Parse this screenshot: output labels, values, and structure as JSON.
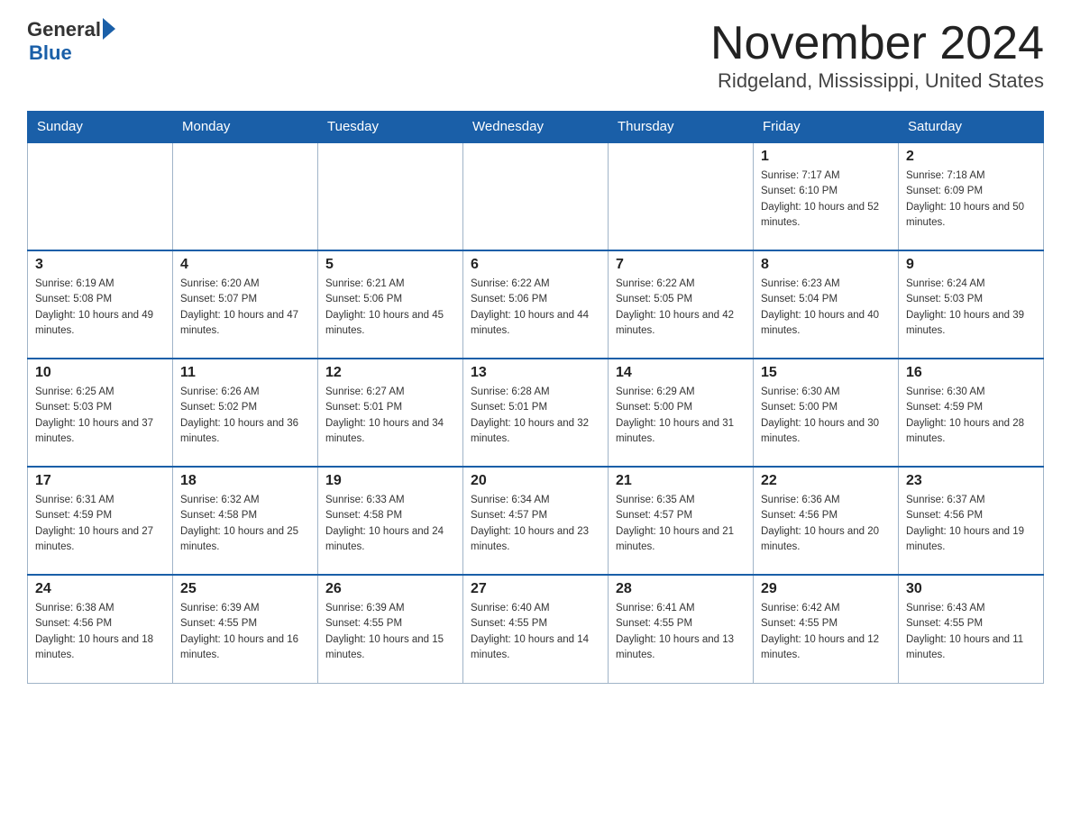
{
  "logo": {
    "general": "General",
    "blue": "Blue"
  },
  "title": "November 2024",
  "subtitle": "Ridgeland, Mississippi, United States",
  "days_of_week": [
    "Sunday",
    "Monday",
    "Tuesday",
    "Wednesday",
    "Thursday",
    "Friday",
    "Saturday"
  ],
  "weeks": [
    [
      {
        "day": "",
        "info": ""
      },
      {
        "day": "",
        "info": ""
      },
      {
        "day": "",
        "info": ""
      },
      {
        "day": "",
        "info": ""
      },
      {
        "day": "",
        "info": ""
      },
      {
        "day": "1",
        "info": "Sunrise: 7:17 AM\nSunset: 6:10 PM\nDaylight: 10 hours and 52 minutes."
      },
      {
        "day": "2",
        "info": "Sunrise: 7:18 AM\nSunset: 6:09 PM\nDaylight: 10 hours and 50 minutes."
      }
    ],
    [
      {
        "day": "3",
        "info": "Sunrise: 6:19 AM\nSunset: 5:08 PM\nDaylight: 10 hours and 49 minutes."
      },
      {
        "day": "4",
        "info": "Sunrise: 6:20 AM\nSunset: 5:07 PM\nDaylight: 10 hours and 47 minutes."
      },
      {
        "day": "5",
        "info": "Sunrise: 6:21 AM\nSunset: 5:06 PM\nDaylight: 10 hours and 45 minutes."
      },
      {
        "day": "6",
        "info": "Sunrise: 6:22 AM\nSunset: 5:06 PM\nDaylight: 10 hours and 44 minutes."
      },
      {
        "day": "7",
        "info": "Sunrise: 6:22 AM\nSunset: 5:05 PM\nDaylight: 10 hours and 42 minutes."
      },
      {
        "day": "8",
        "info": "Sunrise: 6:23 AM\nSunset: 5:04 PM\nDaylight: 10 hours and 40 minutes."
      },
      {
        "day": "9",
        "info": "Sunrise: 6:24 AM\nSunset: 5:03 PM\nDaylight: 10 hours and 39 minutes."
      }
    ],
    [
      {
        "day": "10",
        "info": "Sunrise: 6:25 AM\nSunset: 5:03 PM\nDaylight: 10 hours and 37 minutes."
      },
      {
        "day": "11",
        "info": "Sunrise: 6:26 AM\nSunset: 5:02 PM\nDaylight: 10 hours and 36 minutes."
      },
      {
        "day": "12",
        "info": "Sunrise: 6:27 AM\nSunset: 5:01 PM\nDaylight: 10 hours and 34 minutes."
      },
      {
        "day": "13",
        "info": "Sunrise: 6:28 AM\nSunset: 5:01 PM\nDaylight: 10 hours and 32 minutes."
      },
      {
        "day": "14",
        "info": "Sunrise: 6:29 AM\nSunset: 5:00 PM\nDaylight: 10 hours and 31 minutes."
      },
      {
        "day": "15",
        "info": "Sunrise: 6:30 AM\nSunset: 5:00 PM\nDaylight: 10 hours and 30 minutes."
      },
      {
        "day": "16",
        "info": "Sunrise: 6:30 AM\nSunset: 4:59 PM\nDaylight: 10 hours and 28 minutes."
      }
    ],
    [
      {
        "day": "17",
        "info": "Sunrise: 6:31 AM\nSunset: 4:59 PM\nDaylight: 10 hours and 27 minutes."
      },
      {
        "day": "18",
        "info": "Sunrise: 6:32 AM\nSunset: 4:58 PM\nDaylight: 10 hours and 25 minutes."
      },
      {
        "day": "19",
        "info": "Sunrise: 6:33 AM\nSunset: 4:58 PM\nDaylight: 10 hours and 24 minutes."
      },
      {
        "day": "20",
        "info": "Sunrise: 6:34 AM\nSunset: 4:57 PM\nDaylight: 10 hours and 23 minutes."
      },
      {
        "day": "21",
        "info": "Sunrise: 6:35 AM\nSunset: 4:57 PM\nDaylight: 10 hours and 21 minutes."
      },
      {
        "day": "22",
        "info": "Sunrise: 6:36 AM\nSunset: 4:56 PM\nDaylight: 10 hours and 20 minutes."
      },
      {
        "day": "23",
        "info": "Sunrise: 6:37 AM\nSunset: 4:56 PM\nDaylight: 10 hours and 19 minutes."
      }
    ],
    [
      {
        "day": "24",
        "info": "Sunrise: 6:38 AM\nSunset: 4:56 PM\nDaylight: 10 hours and 18 minutes."
      },
      {
        "day": "25",
        "info": "Sunrise: 6:39 AM\nSunset: 4:55 PM\nDaylight: 10 hours and 16 minutes."
      },
      {
        "day": "26",
        "info": "Sunrise: 6:39 AM\nSunset: 4:55 PM\nDaylight: 10 hours and 15 minutes."
      },
      {
        "day": "27",
        "info": "Sunrise: 6:40 AM\nSunset: 4:55 PM\nDaylight: 10 hours and 14 minutes."
      },
      {
        "day": "28",
        "info": "Sunrise: 6:41 AM\nSunset: 4:55 PM\nDaylight: 10 hours and 13 minutes."
      },
      {
        "day": "29",
        "info": "Sunrise: 6:42 AM\nSunset: 4:55 PM\nDaylight: 10 hours and 12 minutes."
      },
      {
        "day": "30",
        "info": "Sunrise: 6:43 AM\nSunset: 4:55 PM\nDaylight: 10 hours and 11 minutes."
      }
    ]
  ]
}
